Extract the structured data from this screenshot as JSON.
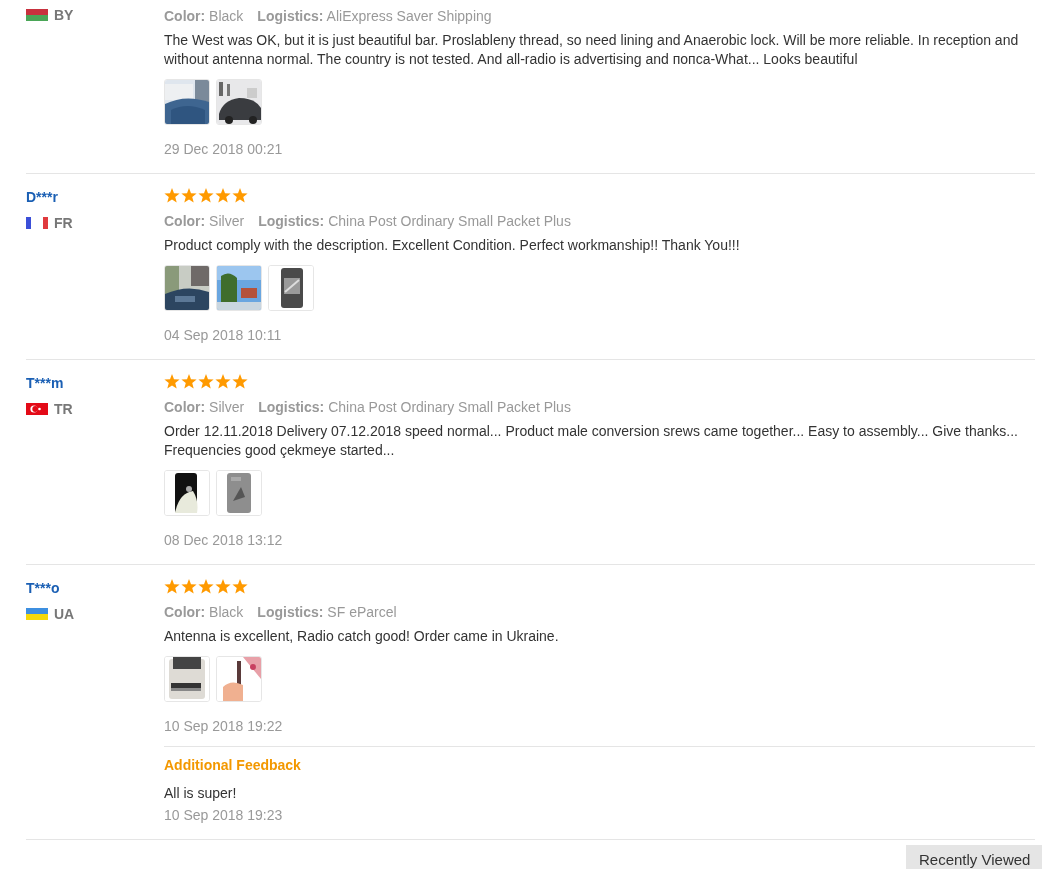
{
  "reviews": [
    {
      "flag": {
        "kind": "belarus"
      },
      "country": "BY",
      "color_label": "Color:",
      "color_value": "Black",
      "logistics_label": "Logistics:",
      "logistics_value": "AliExpress Saver Shipping",
      "text": "The West was OK, but it is just beautiful bar. Proslableny thread, so need lining and Anaerobic lock. Will be more reliable. In reception and without antenna normal. The country is not tested. And all-radio is advertising and попса-What... Looks beautiful",
      "photos": [
        {
          "kind": "picture"
        },
        {
          "kind": "picture"
        }
      ],
      "date": "29 Dec 2018 00:21"
    },
    {
      "name": "D***r",
      "stars": 5,
      "flag": {
        "kind": "france"
      },
      "country": "FR",
      "color_label": "Color:",
      "color_value": "Silver",
      "logistics_label": "Logistics:",
      "logistics_value": "China Post Ordinary Small Packet Plus",
      "text": "Product comply with the description. Excellent Condition. Perfect workmanship!! Thank You!!!",
      "photos": [
        {
          "kind": "picture"
        },
        {
          "kind": "picture"
        },
        {
          "kind": "picture"
        }
      ],
      "date": "04 Sep 2018 10:11"
    },
    {
      "name": "T***m",
      "stars": 5,
      "flag": {
        "kind": "turkey"
      },
      "country": "TR",
      "color_label": "Color:",
      "color_value": "Silver",
      "logistics_label": "Logistics:",
      "logistics_value": "China Post Ordinary Small Packet Plus",
      "text": "Order 12.11.2018 Delivery 07.12.2018 speed normal... Product male conversion srews came together... Easy to assembly... Give thanks... Frequencies good çekmeye started...",
      "photos": [
        {
          "kind": "picture"
        },
        {
          "kind": "picture"
        }
      ],
      "date": "08 Dec 2018 13:12"
    },
    {
      "name": "T***o",
      "stars": 5,
      "flag": {
        "kind": "ukraine"
      },
      "country": "UA",
      "color_label": "Color:",
      "color_value": "Black",
      "logistics_label": "Logistics:",
      "logistics_value": "SF eParcel",
      "text": "Antenna is excellent, Radio catch good! Order came in Ukraine.",
      "photos": [
        {
          "kind": "picture"
        },
        {
          "kind": "picture"
        }
      ],
      "date": "10 Sep 2018 19:22",
      "additional": {
        "title": "Additional Feedback",
        "text": "All is super!",
        "date": "10 Sep 2018 19:23"
      }
    }
  ],
  "recently_viewed": "Recently Viewed"
}
